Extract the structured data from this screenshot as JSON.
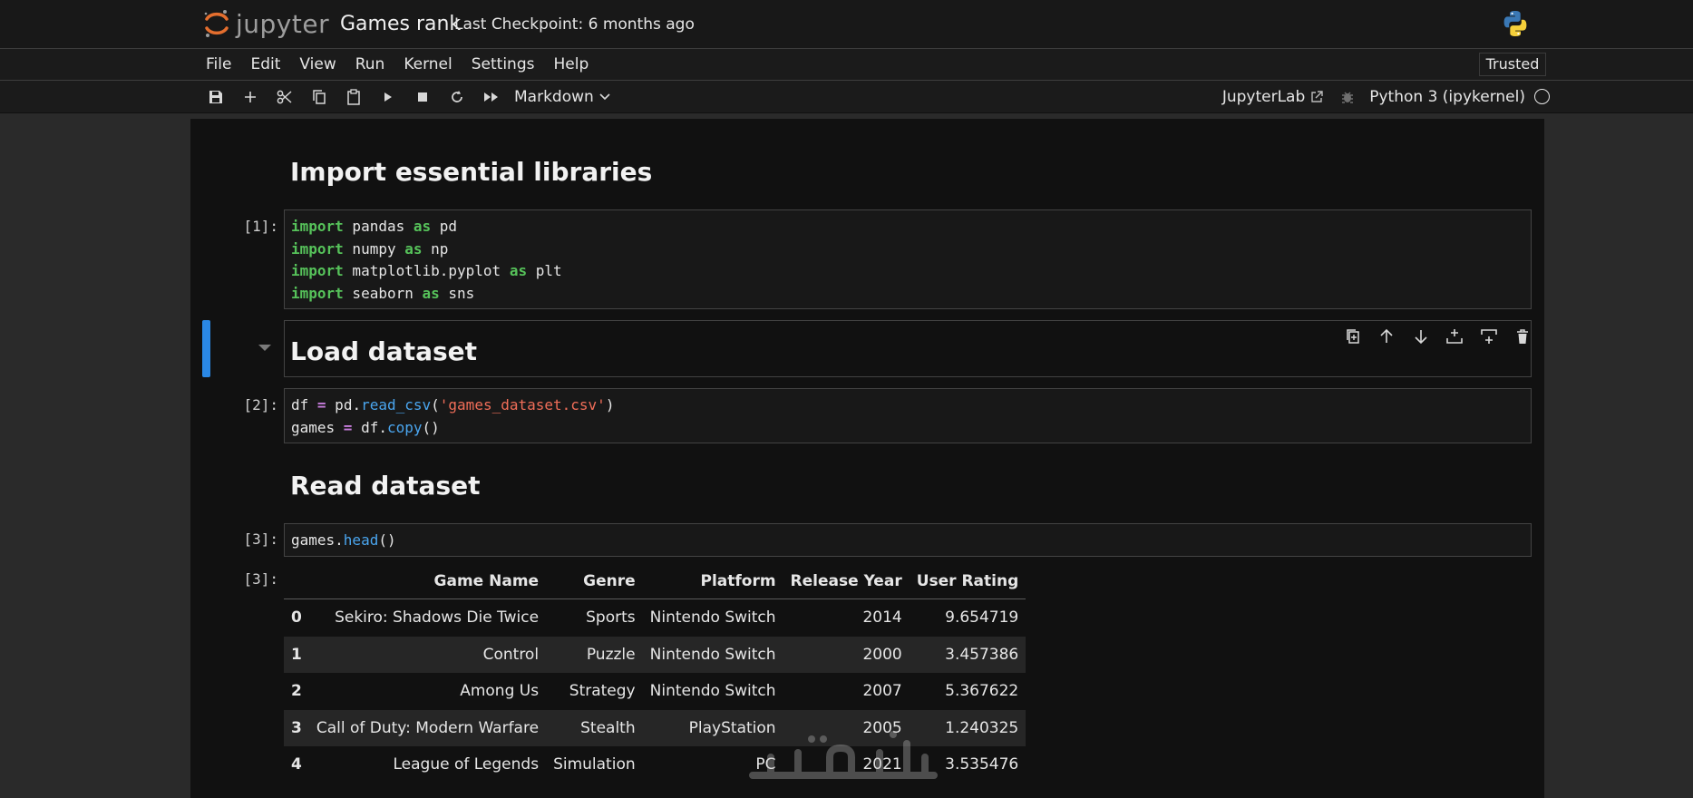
{
  "header": {
    "logo_text": "jupyter",
    "notebook_title": "Games rank",
    "checkpoint": "Last Checkpoint: 6 months ago",
    "kernel_icon": "python-logo-icon"
  },
  "menu": {
    "items": [
      "File",
      "Edit",
      "View",
      "Run",
      "Kernel",
      "Settings",
      "Help"
    ],
    "trusted": "Trusted"
  },
  "toolbar": {
    "icons": [
      "save-icon",
      "add-cell-icon",
      "cut-icon",
      "copy-icon",
      "paste-icon",
      "run-icon",
      "stop-icon",
      "restart-icon",
      "fast-forward-icon"
    ],
    "cell_type": "Markdown",
    "jupyterlab_link": "JupyterLab",
    "kernel_name": "Python 3 (ipykernel)"
  },
  "cells": {
    "h1": "Import essential libraries",
    "c1_prompt": "[1]:",
    "c1_lines": [
      {
        "kw1": "import",
        "mod": " pandas ",
        "kw2": "as",
        "alias": " pd"
      },
      {
        "kw1": "import",
        "mod": " numpy ",
        "kw2": "as",
        "alias": " np"
      },
      {
        "kw1": "import",
        "mod": " matplotlib.pyplot ",
        "kw2": "as",
        "alias": " plt"
      },
      {
        "kw1": "import",
        "mod": " seaborn ",
        "kw2": "as",
        "alias": " sns"
      }
    ],
    "h2": "Load dataset",
    "c2_prompt": "[2]:",
    "c2_l1": {
      "var": "df ",
      "eq": "=",
      "obj": " pd.",
      "fn": "read_csv",
      "open": "(",
      "str": "'games_dataset.csv'",
      "close": ")"
    },
    "c2_l2": {
      "var": "games ",
      "eq": "=",
      "obj": " df.",
      "fn": "copy",
      "call": "()"
    },
    "h3": "Read dataset",
    "c3_prompt": "[3]:",
    "c3_line": {
      "obj": "games.",
      "fn": "head",
      "call": "()"
    },
    "out3_prompt": "[3]:"
  },
  "cell_toolbar": [
    "duplicate-icon",
    "move-up-icon",
    "move-down-icon",
    "insert-above-icon",
    "insert-below-icon",
    "delete-icon"
  ],
  "table": {
    "columns": [
      "",
      "Game Name",
      "Genre",
      "Platform",
      "Release Year",
      "User Rating"
    ],
    "rows": [
      [
        "0",
        "Sekiro: Shadows Die Twice",
        "Sports",
        "Nintendo Switch",
        "2014",
        "9.654719"
      ],
      [
        "1",
        "Control",
        "Puzzle",
        "Nintendo Switch",
        "2000",
        "3.457386"
      ],
      [
        "2",
        "Among Us",
        "Strategy",
        "Nintendo Switch",
        "2007",
        "5.367622"
      ],
      [
        "3",
        "Call of Duty: Modern Warfare",
        "Stealth",
        "PlayStation",
        "2005",
        "1.240325"
      ],
      [
        "4",
        "League of Legends",
        "Simulation",
        "PC",
        "2021",
        "3.535476"
      ]
    ]
  },
  "colors": {
    "accent": "#2a88e6",
    "keyword": "#56c25a",
    "operator": "#c77ddc",
    "function": "#4aa5ee",
    "string": "#ef6d58",
    "jupyter_orange": "#e46e2e"
  }
}
